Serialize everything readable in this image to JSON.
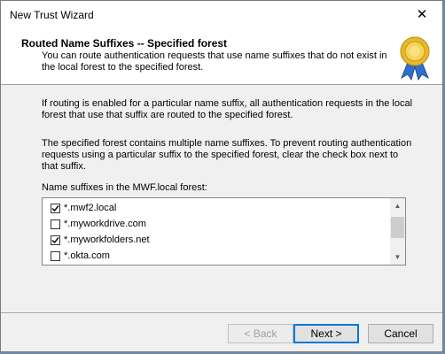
{
  "window": {
    "title": "New Trust Wizard",
    "close_glyph": "✕"
  },
  "header": {
    "title": "Routed Name Suffixes -- Specified forest",
    "subtitle": "You can route authentication requests that use name suffixes that do not exist in the local forest to the specified forest.",
    "icon": "award-seal-icon"
  },
  "body": {
    "paragraph1": "If routing is enabled for a particular name suffix, all authentication requests in the local forest that use that suffix are routed to the specified forest.",
    "paragraph2": "The specified forest contains multiple name suffixes. To prevent routing authentication requests using a particular suffix to the specified forest, clear the check box next to that suffix.",
    "list_label": "Name suffixes in the MWF.local forest:"
  },
  "suffixes": [
    {
      "label": "*.mwf2.local",
      "checked": true
    },
    {
      "label": "*.myworkdrive.com",
      "checked": false
    },
    {
      "label": "*.myworkfolders.net",
      "checked": true
    },
    {
      "label": "*.okta.com",
      "checked": false
    }
  ],
  "buttons": {
    "back": "< Back",
    "next": "Next >",
    "cancel": "Cancel"
  },
  "colors": {
    "accent": "#0078d7",
    "seal_gold": "#e8b82a",
    "ribbon_blue": "#2f6fc8"
  }
}
